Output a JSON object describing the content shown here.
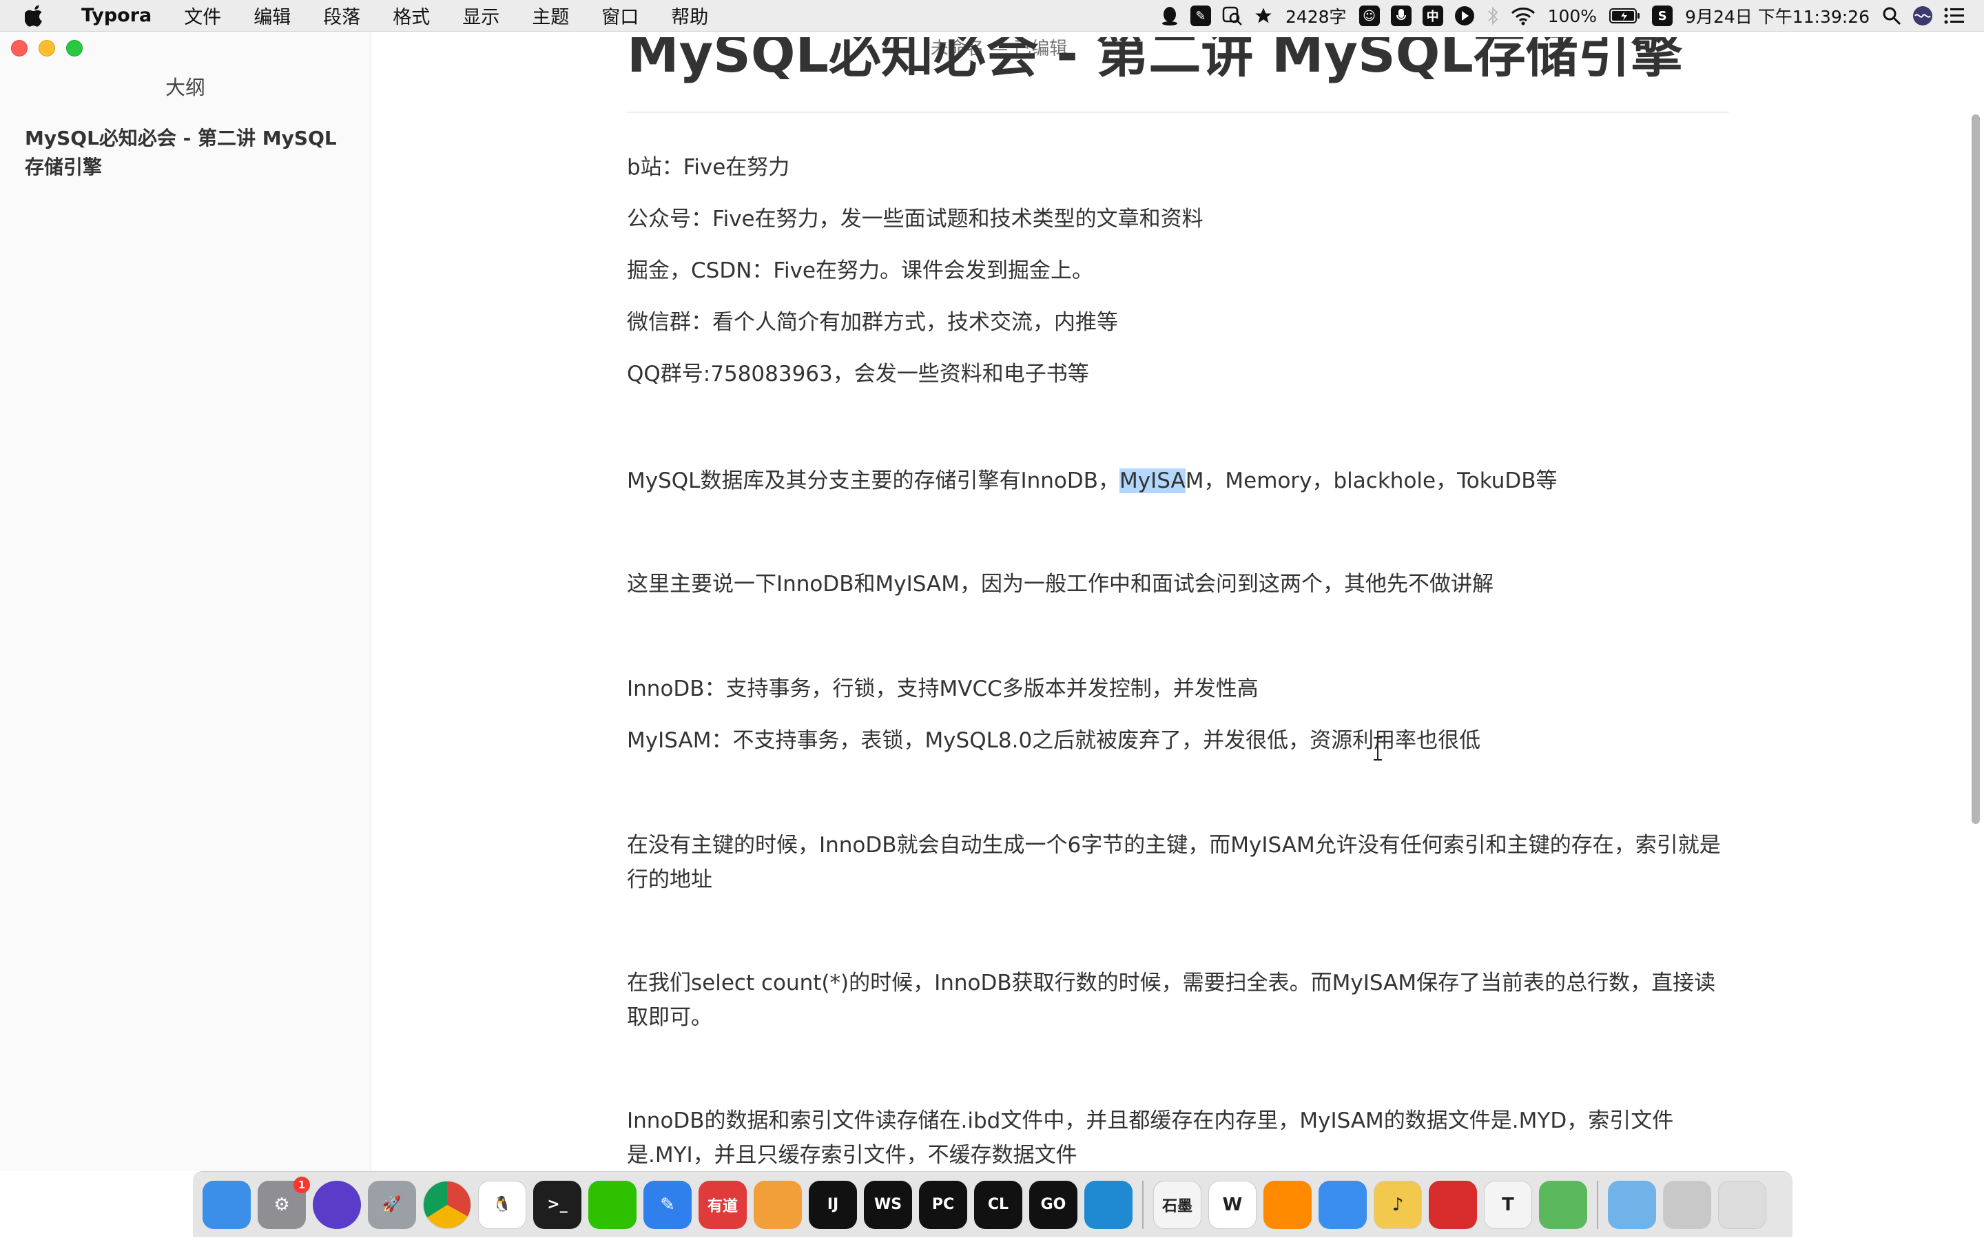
{
  "menubar": {
    "app_name": "Typora",
    "items": [
      "文件",
      "编辑",
      "段落",
      "格式",
      "显示",
      "主题",
      "窗口",
      "帮助"
    ],
    "word_count": "2428字",
    "battery": "100%",
    "datetime": "9月24日 下午11:39:26",
    "input_method_char": "中"
  },
  "window": {
    "title": "未命名 — 已编辑"
  },
  "sidebar": {
    "heading": "大纲",
    "outline_item": "MySQL必知必会 - 第二讲 MySQL存储引擎"
  },
  "document": {
    "title": "MySQL必知必会 - 第二讲 MySQL存储引擎",
    "p_bilibili": "b站：Five在努力",
    "p_gzh": "公众号：Five在努力，发一些面试题和技术类型的文章和资料",
    "p_juejin": "掘金，CSDN：Five在努力。课件会发到掘金上。",
    "p_wechat": "微信群：看个人简介有加群方式，技术交流，内推等",
    "p_qq": "QQ群号:758083963，会发一些资料和电子书等",
    "p_engines_before": "MySQL数据库及其分支主要的存储引擎有InnoDB，",
    "p_engines_highlight": "MyISA",
    "p_engines_after": "M，Memory，blackhole，TokuDB等",
    "p_focus": "这里主要说一下InnoDB和MyISAM，因为一般工作中和面试会问到这两个，其他先不做讲解",
    "p_innodb": "InnoDB：支持事务，行锁，支持MVCC多版本并发控制，并发性高",
    "p_myisam": "MyISAM：不支持事务，表锁，MySQL8.0之后就被废弃了，并发很低，资源利用率也很低",
    "p_primary_key": "在没有主键的时候，InnoDB就会自动生成一个6字节的主键，而MyISAM允许没有任何索引和主键的存在，索引就是行的地址",
    "p_count": "在我们select count(*)的时候，InnoDB获取行数的时候，需要扫全表。而MyISAM保存了当前表的总行数，直接读取即可。",
    "p_files": "InnoDB的数据和索引文件读存储在.ibd文件中，并且都缓存在内存里，MyISAM的数据文件是.MYD，索引文件是.MYI，并且只缓存索引文件，不缓存数据文件"
  },
  "dock": {
    "settings_badge": "1",
    "apps": [
      {
        "name": "finder",
        "label": "",
        "color": "#3b8fe8"
      },
      {
        "name": "system-preferences",
        "label": "⚙",
        "color": "#8e8e93"
      },
      {
        "name": "siri",
        "label": "",
        "color": "#5a3cc8"
      },
      {
        "name": "launchpad",
        "label": "🚀",
        "color": "#9aa0a6"
      },
      {
        "name": "chrome",
        "label": "",
        "color": "#ffffff"
      },
      {
        "name": "qq",
        "label": "🐧",
        "color": "#ffffff"
      },
      {
        "name": "terminal",
        "label": ">_",
        "color": "#1e1e1e"
      },
      {
        "name": "wechat",
        "label": "",
        "color": "#2dc100"
      },
      {
        "name": "notes-app",
        "label": "✎",
        "color": "#2f80ed"
      },
      {
        "name": "youdao",
        "label": "有道",
        "color": "#e03a3a"
      },
      {
        "name": "painting-app",
        "label": "",
        "color": "#f29f3a"
      },
      {
        "name": "intellij",
        "label": "IJ",
        "color": "#111111"
      },
      {
        "name": "webstorm",
        "label": "WS",
        "color": "#111111"
      },
      {
        "name": "pycharm",
        "label": "PC",
        "color": "#111111"
      },
      {
        "name": "clion",
        "label": "CL",
        "color": "#111111"
      },
      {
        "name": "goland",
        "label": "GO",
        "color": "#111111"
      },
      {
        "name": "vscode",
        "label": "",
        "color": "#1f8ad2"
      },
      {
        "name": "shimo",
        "label": "石墨",
        "color": "#f4f4f4"
      },
      {
        "name": "wps",
        "label": "W",
        "color": "#ffffff"
      },
      {
        "name": "photos-app",
        "label": "",
        "color": "#ff8a00"
      },
      {
        "name": "baidu-netdisk",
        "label": "",
        "color": "#3a8ef0"
      },
      {
        "name": "music-app",
        "label": "♪",
        "color": "#f2c94c"
      },
      {
        "name": "netease-music",
        "label": "",
        "color": "#d82c2c"
      },
      {
        "name": "typora",
        "label": "T",
        "color": "#f4f4f4"
      },
      {
        "name": "eudic",
        "label": "",
        "color": "#5cb85c"
      },
      {
        "name": "downloads",
        "label": "",
        "color": "#6fb3e8"
      },
      {
        "name": "screenshots-folder",
        "label": "",
        "color": "#c8c8c8"
      },
      {
        "name": "trash",
        "label": "",
        "color": "#dcdcdc"
      }
    ]
  }
}
